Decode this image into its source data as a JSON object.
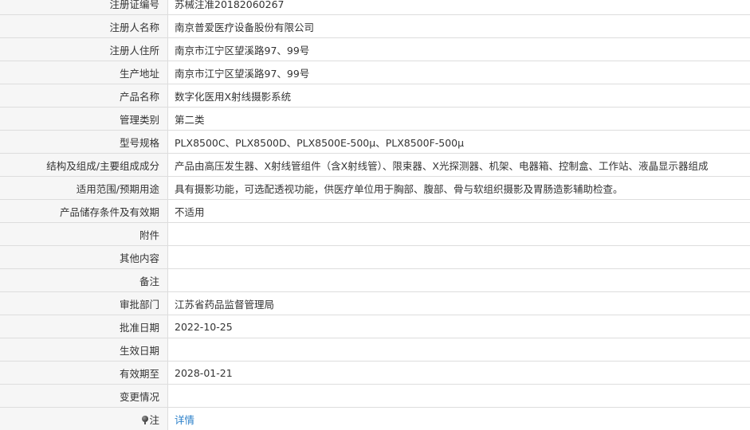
{
  "rows": [
    {
      "label": "注册证编号",
      "value": "苏械注准20182060267"
    },
    {
      "label": "注册人名称",
      "value": "南京普爱医疗设备股份有限公司"
    },
    {
      "label": "注册人住所",
      "value": "南京市江宁区望溪路97、99号"
    },
    {
      "label": "生产地址",
      "value": "南京市江宁区望溪路97、99号"
    },
    {
      "label": "产品名称",
      "value": "数字化医用X射线摄影系统"
    },
    {
      "label": "管理类别",
      "value": "第二类"
    },
    {
      "label": "型号规格",
      "value": "PLX8500C、PLX8500D、PLX8500E-500μ、PLX8500F-500μ"
    },
    {
      "label": "结构及组成/主要组成成分",
      "value": "产品由高压发生器、X射线管组件（含X射线管）、限束器、X光探测器、机架、电器箱、控制盒、工作站、液晶显示器组成"
    },
    {
      "label": "适用范围/预期用途",
      "value": "具有摄影功能，可选配透视功能，供医疗单位用于胸部、腹部、骨与软组织摄影及胃肠造影辅助检查。"
    },
    {
      "label": "产品储存条件及有效期",
      "value": "不适用"
    },
    {
      "label": "附件",
      "value": ""
    },
    {
      "label": "其他内容",
      "value": ""
    },
    {
      "label": "备注",
      "value": ""
    },
    {
      "label": "审批部门",
      "value": "江苏省药品监督管理局"
    },
    {
      "label": "批准日期",
      "value": "2022-10-25"
    },
    {
      "label": "生效日期",
      "value": ""
    },
    {
      "label": "有效期至",
      "value": "2028-01-21"
    },
    {
      "label": "变更情况",
      "value": ""
    }
  ],
  "footer_row": {
    "icon": "pin-icon",
    "label": "注",
    "link_text": "详情",
    "link_color": "#2a7fc9"
  }
}
